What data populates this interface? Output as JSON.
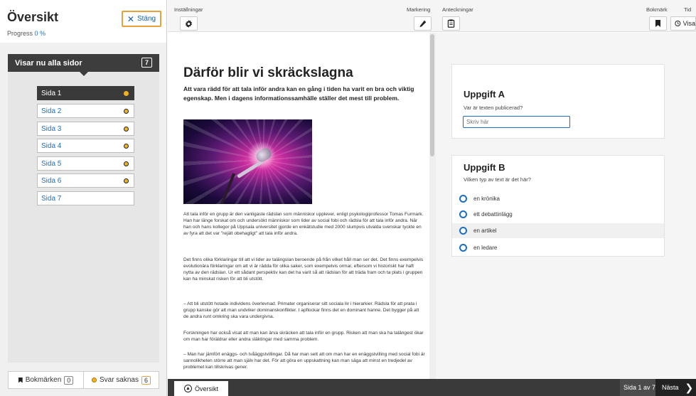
{
  "sidebar": {
    "title": "Översikt",
    "progress_label": "Progress",
    "progress_value": "0 %",
    "close_label": "Stäng",
    "showing_label": "Visar nu alla sidor",
    "page_count": "7",
    "pages": [
      {
        "label": "Sida 1",
        "active": true,
        "unanswered": true
      },
      {
        "label": "Sida 2",
        "active": false,
        "unanswered": true
      },
      {
        "label": "Sida 3",
        "active": false,
        "unanswered": true
      },
      {
        "label": "Sida 4",
        "active": false,
        "unanswered": true
      },
      {
        "label": "Sida 5",
        "active": false,
        "unanswered": true
      },
      {
        "label": "Sida 6",
        "active": false,
        "unanswered": true
      },
      {
        "label": "Sida 7",
        "active": false,
        "unanswered": false
      }
    ],
    "footer": {
      "bookmarks_label": "Bokmärken",
      "bookmarks_count": "0",
      "missing_label": "Svar saknas",
      "missing_count": "6"
    }
  },
  "toolbar": {
    "settings_label": "Inställningar",
    "marking_label": "Markering",
    "notes_label": "Anteckningar",
    "bookmark_label": "Bokmärk",
    "time_label": "Tid",
    "time_button_text": "Visa"
  },
  "article": {
    "title": "Därför blir vi skräckslagna",
    "lead": "Att vara rädd för att tala inför andra kan en gång i tiden ha varit en bra och viktig egenskap. Men i dagens informationssamhälle ställer det mest till problem.",
    "paragraphs": [
      "Att tala inför en grupp är den vanligaste rädslan som människor upplever, enligt psykologiprofessor Tomas Furmark. Han har länge forskat om och undersökt människor som lider av social fobi och rädsla för att tala inför andra. När han och hans kollegor på Uppsala universitet gjorde en enkätstudie med 2000 slumpvis utvalda svenskar tyckte en av fyra att det var \"rejält obehagligt\" att tala inför andra.",
      "Det finns olika förklaringar till att vi lider av talängslan beroende på från vilket håll man ser det. Det finns exempelvis evolutionära förklaringar om att vi är rädda för olika saker, som exempelvis ormar, eftersom vi historiskt har haft nytta av den rädslan. Ur ett sådant perspektiv kan det ha varit så att rädslan för att träda fram och ta plats i gruppen kan ha minskat risken för att bli utstött.",
      "– Att bli utstött hotade individens överlevnad. Primater organiserar sitt sociala liv i hierarkier. Rädsla för att prata i grupp kanske gör att man undviker dominanskonflikter. I apflockar finns det en dominant hanne. Det bygger på att de andra runt omkring ska vara undergivna.",
      "Forskningen har också visat att man kan ärva skräcken att tala inför en grupp. Risken att man ska ha talängest ökar om man har föräldrar eller andra släktingar med samma problem.",
      "– Man har jämfört enäggs- och tvåäggstvillingar. Då har man sett att om man har en enäggstvilling med social fobi är sannolikheten större att man själv har det. För att göra en uppskattning kan man säga att minst en tredjedel av problemet kan tillskrivas gener."
    ]
  },
  "questions": {
    "a": {
      "title": "Uppgift A",
      "prompt": "Var är texten publicerad?",
      "placeholder": "Skriv här"
    },
    "b": {
      "title": "Uppgift B",
      "prompt": "Vilken typ av text är det här?",
      "options": [
        "en krönika",
        "ett debattinlägg",
        "en artikel",
        "en ledare"
      ]
    }
  },
  "footer": {
    "overview_label": "Översikt",
    "page_indicator": "Sida 1 av 7",
    "next_label": "Nästa"
  },
  "colors": {
    "accent_blue": "#1a6fc4",
    "warning_orange": "#e8a23a",
    "dot_yellow": "#f2b31c",
    "dark_bar": "#3a3a3a"
  }
}
